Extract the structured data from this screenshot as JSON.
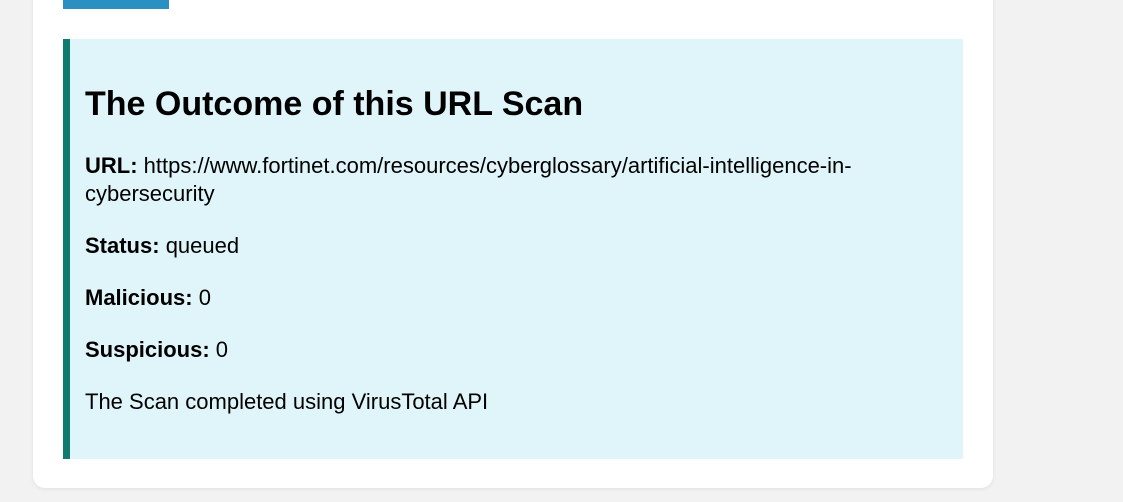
{
  "colors": {
    "page_background": "#f2f2f2",
    "card_background": "#ffffff",
    "button_color": "#2a8fc1",
    "result_background": "#e0f5fa",
    "result_accent": "#0f7a6e"
  },
  "result": {
    "title": "The Outcome of this URL Scan",
    "url_label": "URL:",
    "url_value": "https://www.fortinet.com/resources/cyberglossary/artificial-intelligence-in-cybersecurity",
    "status_label": "Status:",
    "status_value": "queued",
    "malicious_label": "Malicious:",
    "malicious_value": "0",
    "suspicious_label": "Suspicious:",
    "suspicious_value": "0",
    "footer_note": "The Scan completed using VirusTotal API"
  }
}
